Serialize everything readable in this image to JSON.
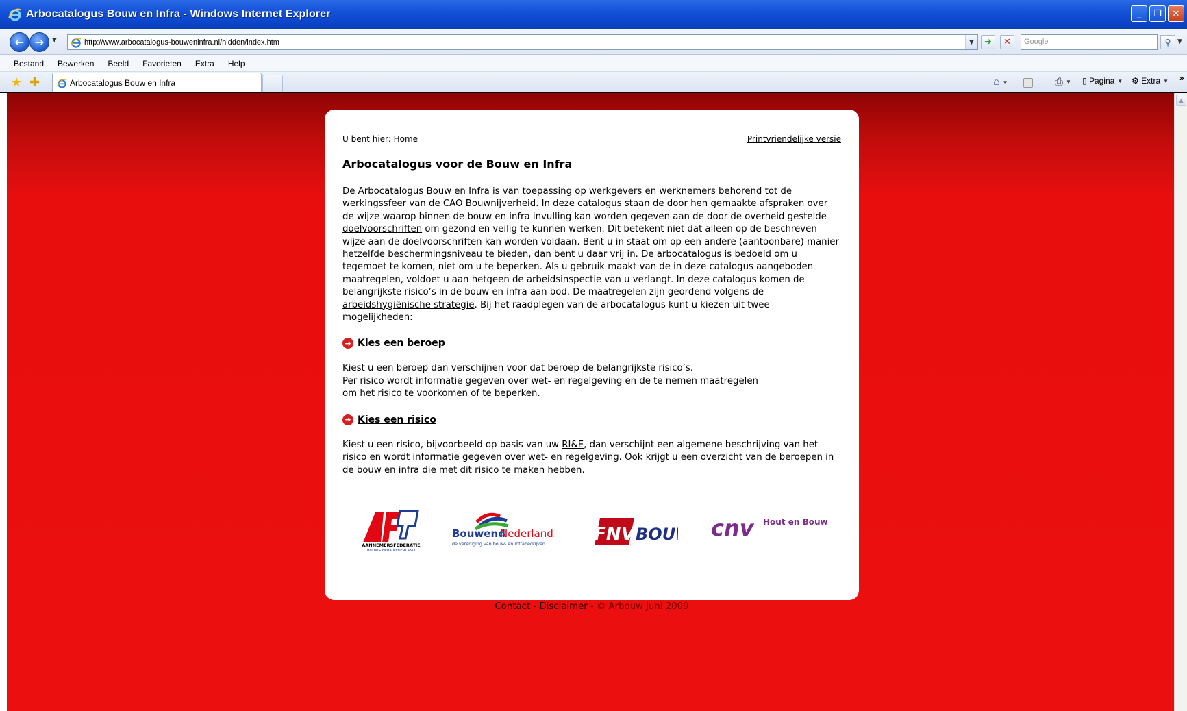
{
  "window": {
    "title": "Arbocatalogus Bouw en Infra - Windows Internet Explorer",
    "buttons": {
      "minimize": "_",
      "maximize": "❐",
      "close": "✕"
    }
  },
  "address": {
    "url": "http://www.arbocatalogus-bouweninfra.nl/hidden/index.htm",
    "search_placeholder": "Google"
  },
  "menu": {
    "items": [
      "Bestand",
      "Bewerken",
      "Beeld",
      "Favorieten",
      "Extra",
      "Help"
    ]
  },
  "tabs": {
    "active_label": "Arbocatalogus Bouw en Infra"
  },
  "commandbar": {
    "page_label": "Pagina",
    "tools_label": "Extra",
    "more": "»"
  },
  "page": {
    "breadcrumb": "U bent hier: Home",
    "print_link": "Printvriendelijke versie",
    "title": "Arbocatalogus voor de Bouw en Infra",
    "intro": {
      "part1": "De Arbocatalogus Bouw en Infra is van toepassing op werkgevers en werknemers behorend tot de werkingssfeer van de CAO Bouwnijverheid. In deze catalogus staan de door hen gemaakte afspraken over de wijze waarop binnen de bouw en infra invulling kan worden gegeven aan de door de overheid gestelde ",
      "link1": "doelvoorschriften",
      "part2": " om gezond en veilig te kunnen werken. Dit betekent niet dat alleen op de beschreven wijze aan de doelvoorschriften kan worden voldaan. Bent u in staat om op een andere (aantoonbare) manier hetzelfde beschermingsniveau te bieden, dan bent u daar vrij in. De arbocatalogus is bedoeld om u tegemoet te komen, niet om u te beperken. Als u gebruik maakt van de in deze catalogus aangeboden maatregelen, voldoet u aan hetgeen de arbeidsinspectie van u verlangt. In deze catalogus komen de belangrijkste risico’s in de bouw en infra aan bod. De maatregelen zijn geordend volgens de ",
      "link2": "arbeidshygiënische strategie",
      "part3": ". Bij het raadplegen van de arbocatalogus kunt u kiezen uit twee mogelijkheden:"
    },
    "option1": {
      "label": "Kies een beroep",
      "line1": "Kiest u een beroep dan verschijnen voor dat beroep de belangrijkste risico’s.",
      "line2": "Per risico wordt informatie gegeven over wet- en regelgeving en de te nemen maatregelen",
      "line3": "om het risico te voorkomen of te beperken."
    },
    "option2": {
      "label": "Kies een risico",
      "part1": "Kiest u een risico, bijvoorbeeld op basis van uw ",
      "link": "RI&E",
      "part2": ", dan verschijnt een algemene beschrijving van het risico en wordt informatie gegeven over wet- en regelgeving. Ook krijgt u een overzicht van de beroepen in de bouw en infra die met dit risico te maken hebben."
    },
    "logos": {
      "af_line1": "AANNEMERSFEDERATIE",
      "af_line2": "BOUW&INFRA NEDERLAND",
      "bn_name1": "Bouwend",
      "bn_name2": "Nederland",
      "bn_tagline": "de vereniging van bouw- en infrabedrijven",
      "fnv_text": "FNV",
      "fnv_bouw": "BOUW",
      "cnv_text": "cnv",
      "cnv_sub": "Hout en Bouw"
    },
    "footer": {
      "contact": "Contact",
      "sep1": " - ",
      "disclaimer": "Disclaimer",
      "sep2": " - ",
      "copyright": "© Arbouw juni 2009"
    }
  },
  "colors": {
    "page_red": "#ec0f0f",
    "titlebar_blue": "#1452d9",
    "bullet_red": "#d81f1f"
  }
}
